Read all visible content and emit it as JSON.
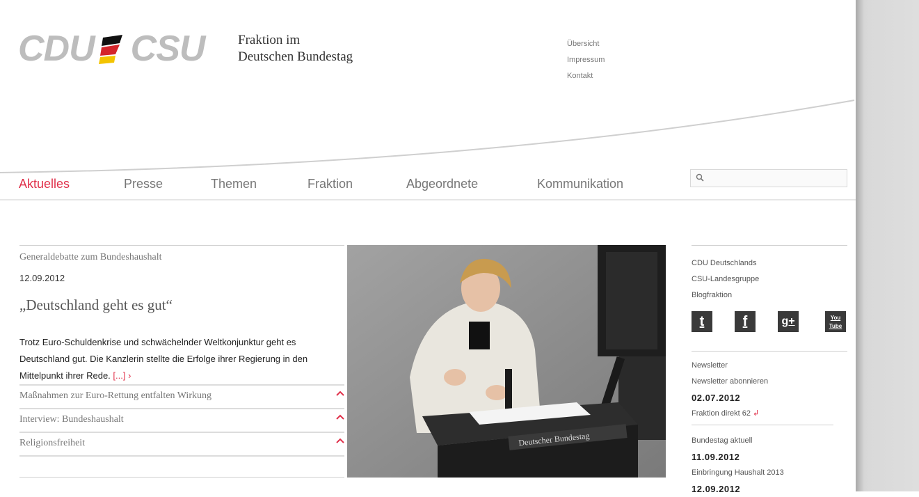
{
  "header": {
    "logo_left": "CDU",
    "logo_right": "CSU",
    "org_line1": "Fraktion im",
    "org_line2": "Deutschen Bundestag",
    "util_links": [
      "Übersicht",
      "Impressum",
      "Kontakt"
    ]
  },
  "nav": {
    "items": [
      "Aktuelles",
      "Presse",
      "Themen",
      "Fraktion",
      "Abgeordnete",
      "Kommunikation"
    ],
    "active": "Aktuelles"
  },
  "search": {
    "placeholder": ""
  },
  "article": {
    "kicker": "Generaldebatte zum Bundeshaushalt",
    "date": "12.09.2012",
    "title": "„Deutschland geht es gut“",
    "teaser": "Trotz Euro-Schuldenkrise und schwächelnder Weltkonjunktur geht es Deutschland gut. Die Kanzlerin stellte die Erfolge ihrer Regierung in den Mittelpunkt ihrer Rede.",
    "more": "[...] ›"
  },
  "related": [
    "Maßnahmen zur Euro-Rettung entfalten Wirkung",
    "Interview: Bundeshaushalt",
    "Religionsfreiheit"
  ],
  "photo": {
    "lectern_text": "Deutscher Bundestag"
  },
  "right": {
    "links": [
      "CDU Deutschlands",
      "CSU-Landesgruppe",
      "Blogfraktion"
    ],
    "social": [
      {
        "icon": "twitter-icon",
        "glyph": "t"
      },
      {
        "icon": "facebook-icon",
        "glyph": "f"
      },
      {
        "icon": "google-plus-icon",
        "glyph": "g+"
      },
      {
        "icon": "youtube-icon",
        "glyph": "You Tube"
      }
    ],
    "newsletter": {
      "heading": "Newsletter",
      "link": "Newsletter abonnieren",
      "date": "02.07.2012",
      "item": "Fraktion direkt 62",
      "item_suffix": "↲"
    },
    "bundestag": {
      "heading": "Bundestag aktuell",
      "date1": "11.09.2012",
      "item1": "Einbringung Haushalt 2013",
      "date2": "12.09.2012"
    }
  },
  "colors": {
    "accent": "#e0304a",
    "logo_grey": "#bdbdbd",
    "flag_black": "#111111",
    "flag_red": "#d4252b",
    "flag_gold": "#f3c400"
  }
}
